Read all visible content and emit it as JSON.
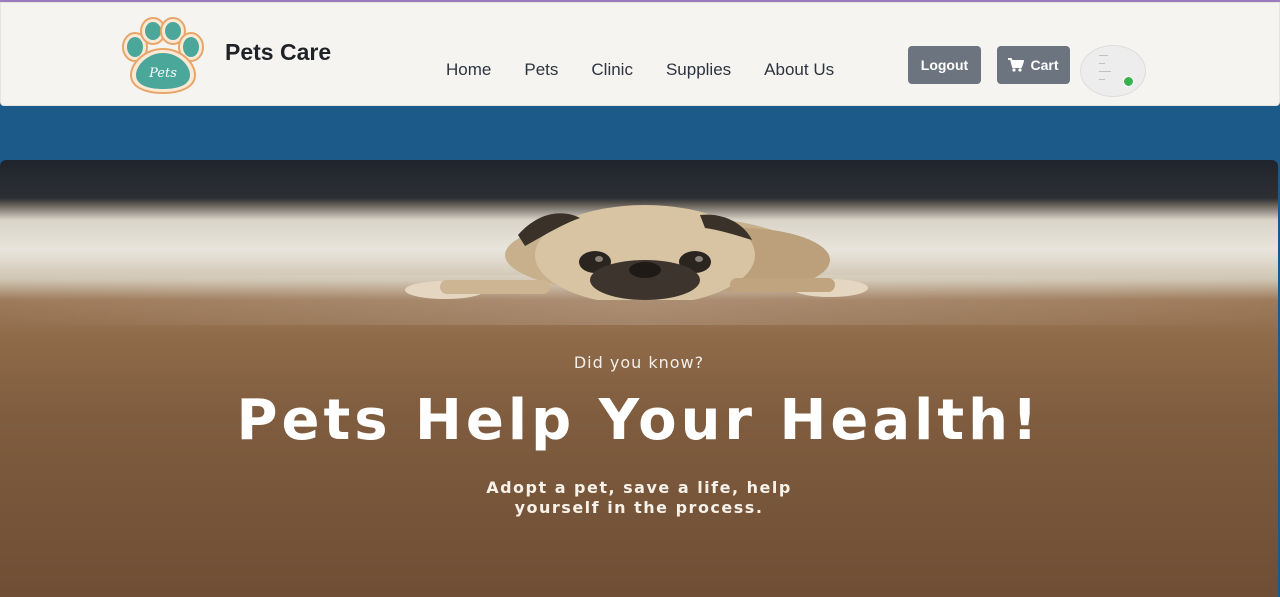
{
  "brand": {
    "name": "Pets Care",
    "logo_text": "Pets",
    "logo_icon": "paw-logo-icon"
  },
  "nav": {
    "items": [
      {
        "label": "Home"
      },
      {
        "label": "Pets"
      },
      {
        "label": "Clinic"
      },
      {
        "label": "Supplies"
      },
      {
        "label": "About Us"
      }
    ]
  },
  "actions": {
    "logout_label": "Logout",
    "cart_label": "Cart",
    "cart_icon": "shopping-cart-icon"
  },
  "user": {
    "status": "online",
    "status_color": "#37b24d"
  },
  "hero": {
    "kicker": "Did you know?",
    "title": "Pets Help Your Health!",
    "subtitle_line1": "Adopt a pet, save a life, help",
    "subtitle_line2": "yourself in the process."
  },
  "colors": {
    "navbar_bg": "#f5f4f0",
    "band_bg": "#1c5a89",
    "button_bg": "#6c747f",
    "logo_teal": "#4aa79a",
    "logo_border": "#e8a66a"
  }
}
